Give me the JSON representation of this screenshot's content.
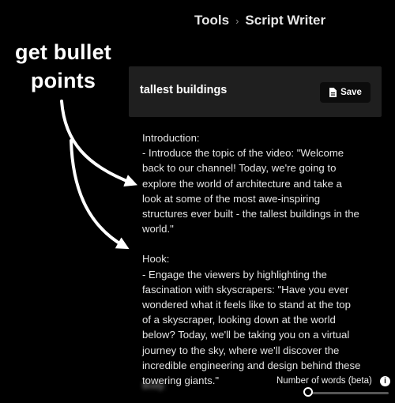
{
  "breadcrumb": {
    "parent": "Tools",
    "current": "Script Writer"
  },
  "annotation": {
    "text": "get bullet points"
  },
  "editor": {
    "title": "tallest buildings",
    "save_label": "Save",
    "paragraphs": [
      "Introduction:\n- Introduce the topic of the video: \"Welcome back to our channel! Today, we're going to explore the world of architecture and take a look at some of the most awe-inspiring structures ever built - the tallest buildings in the world.\"",
      "Hook:\n- Engage the viewers by highlighting the fascination with skyscrapers: \"Have you ever wondered what it feels like to stand at the top of a skyscraper, looking down at the world below? Today, we'll be taking you on a virtual journey to the sky, where we'll discover the incredible engineering and design behind these towering giants.\""
    ],
    "blurred_label": "Body:"
  },
  "words_control": {
    "label": "Number of words (beta)",
    "info_icon": "info-icon"
  }
}
